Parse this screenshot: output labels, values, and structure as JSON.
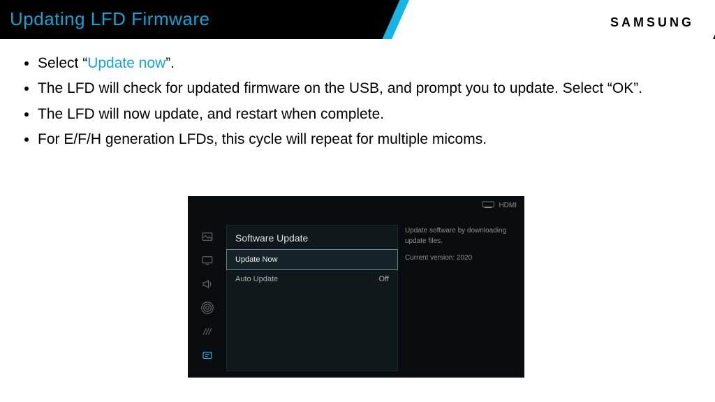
{
  "header": {
    "title": "Updating LFD Firmware",
    "brand": "SAMSUNG"
  },
  "steps": {
    "s1a": "Select “",
    "s1kw": "Update now",
    "s1b": "”.",
    "s2": "The LFD will check for updated firmware on the USB, and prompt you to update. Select “OK”.",
    "s3": "The LFD will now update, and restart when complete.",
    "s4": "For E/F/H generation LFDs, this cycle will repeat for multiple micoms."
  },
  "tv": {
    "source": "HDMI",
    "panel_title": "Software Update",
    "row1": "Update Now",
    "row2": "Auto Update",
    "row2_val": "Off",
    "help1": "Update software by downloading update files.",
    "help2": "Current version: 2020"
  }
}
